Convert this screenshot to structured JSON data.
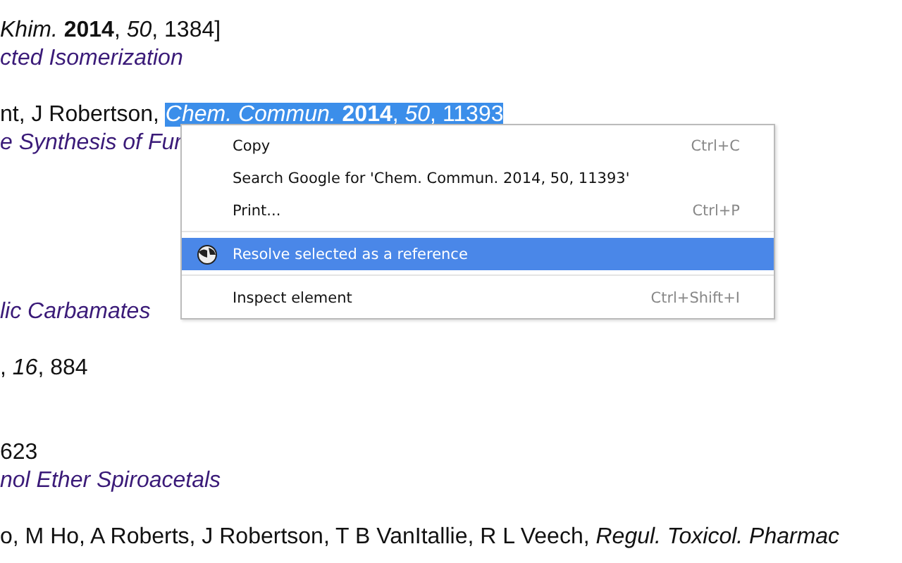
{
  "lines": [
    {
      "kind": "citation",
      "text": "*Khim.* **2014**, *50*, 1384]"
    },
    {
      "kind": "title",
      "text": "cted Isomerization"
    },
    {
      "kind": "citation",
      "text": "nt, J Robertson, ",
      "selection": "*Chem. Commun.* **2014**, *50*, 11393"
    },
    {
      "kind": "title",
      "text": "e Synthesis of Fur"
    },
    {
      "kind": "title",
      "text": "lic Carbamates"
    },
    {
      "kind": "citation",
      "text": ", *16*, 884"
    },
    {
      "kind": "citation",
      "text": "623"
    },
    {
      "kind": "title",
      "text": "nol Ether Spiroacetals"
    },
    {
      "kind": "citation",
      "text": "o, M Ho, A Roberts, J Robertson, T B VanItallie, R L Veech, *Regul. Toxicol. Pharmac*"
    }
  ],
  "context_menu": [
    {
      "kind": "item",
      "label": "Copy",
      "shortcut": "Ctrl+C",
      "selected": false
    },
    {
      "kind": "item",
      "label": "Search Google for 'Chem. Commun. 2014, 50, 11393'",
      "selected": false
    },
    {
      "kind": "item",
      "label": "Print...",
      "shortcut": "Ctrl+P",
      "selected": false
    },
    {
      "kind": "separator"
    },
    {
      "kind": "icon_item",
      "label": "Resolve selected as a reference",
      "selected": true
    },
    {
      "kind": "separator"
    },
    {
      "kind": "item",
      "label": "Inspect element",
      "shortcut": "Ctrl+Shift+I",
      "selected": false
    }
  ]
}
